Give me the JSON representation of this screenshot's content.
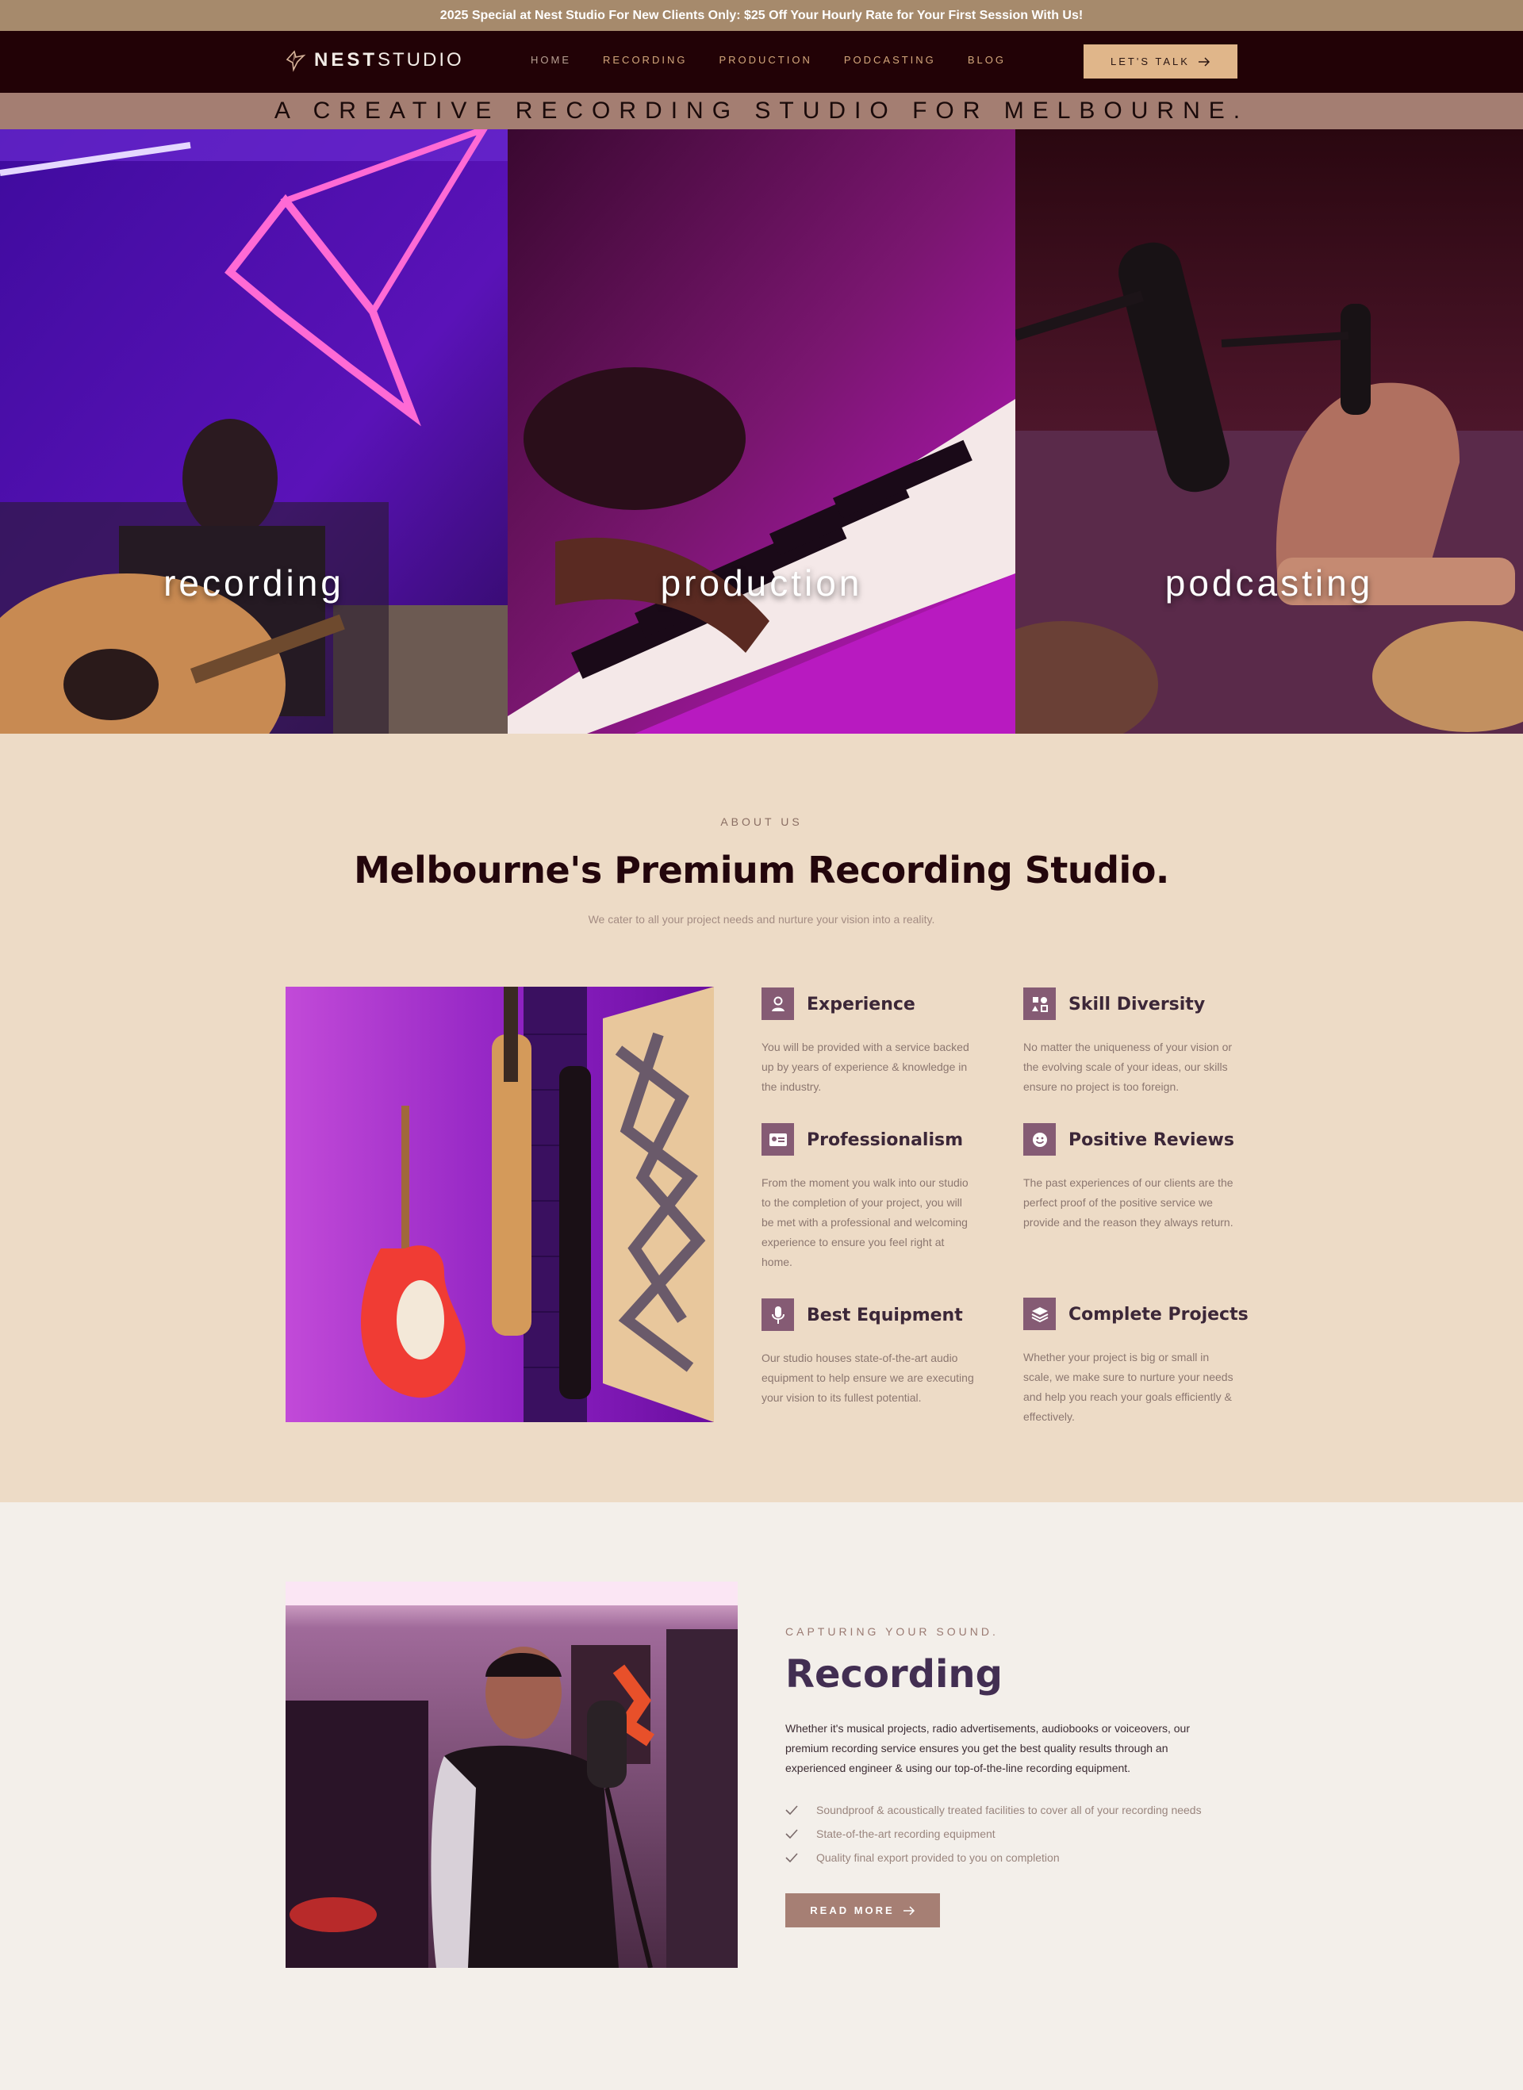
{
  "promo": {
    "text": "2025 Special at Nest Studio For New Clients Only: $25 Off Your Hourly Rate for Your First Session With Us!"
  },
  "header": {
    "logo_bold": "NEST",
    "logo_light": "STUDIO",
    "nav": [
      "HOME",
      "RECORDING",
      "PRODUCTION",
      "PODCASTING",
      "BLOG"
    ],
    "cta_label": "LET'S TALK",
    "cta_icon": "arrow-right-icon"
  },
  "tagline": "A CREATIVE RECORDING STUDIO FOR MELBOURNE.",
  "hero": {
    "panels": [
      {
        "label": "recording"
      },
      {
        "label": "production"
      },
      {
        "label": "podcasting"
      }
    ]
  },
  "about": {
    "eyebrow": "ABOUT US",
    "title": "Melbourne's Premium Recording Studio.",
    "subtitle": "We cater to all your project needs and nurture your vision into a reality.",
    "features": [
      {
        "title": "Experience",
        "icon": "person-icon",
        "text": "You will be provided with a service backed up by years of experience & knowledge in the industry."
      },
      {
        "title": "Skill Diversity",
        "icon": "shapes-icon",
        "text": "No matter the uniqueness of your vision or the evolving scale of your ideas, our skills ensure no project is too foreign."
      },
      {
        "title": "Professionalism",
        "icon": "id-card-icon",
        "text": "From the moment you walk into our studio to the completion of your project, you will be met with a professional and welcoming experience to ensure you feel right at home."
      },
      {
        "title": "Positive Reviews",
        "icon": "smile-icon",
        "text": "The past experiences of our clients are the perfect proof of the positive service we provide and the reason they always return."
      },
      {
        "title": "Best Equipment",
        "icon": "microphone-icon",
        "text": "Our studio houses state-of-the-art audio equipment to help ensure we are executing your vision to its fullest potential."
      },
      {
        "title": "Complete Projects",
        "icon": "layers-icon",
        "text": "Whether your project is big or small in scale, we make sure to nurture your needs and help you reach your goals efficiently & effectively."
      }
    ]
  },
  "recording": {
    "eyebrow": "CAPTURING YOUR SOUND.",
    "title": "Recording",
    "body": "Whether it's musical projects, radio advertisements, audiobooks or voiceovers, our premium recording service ensures you get the best quality results through an experienced engineer & using our top-of-the-line recording equipment.",
    "list": [
      "Soundproof & acoustically treated facilities to cover all of your recording needs",
      "State-of-the-art recording equipment",
      "Quality final export provided to you on completion"
    ],
    "button_label": "READ MORE"
  },
  "colors": {
    "promo_bg": "#a68a6c",
    "header_bg": "#220206",
    "nav_text": "#d4a77c",
    "cta_bg": "#e0b68a",
    "tagline_bg": "#a47e72",
    "about_bg": "#eddbc6",
    "icon_bg": "#855b74",
    "recording_title": "#422e52",
    "button_bg": "#a67f74"
  }
}
